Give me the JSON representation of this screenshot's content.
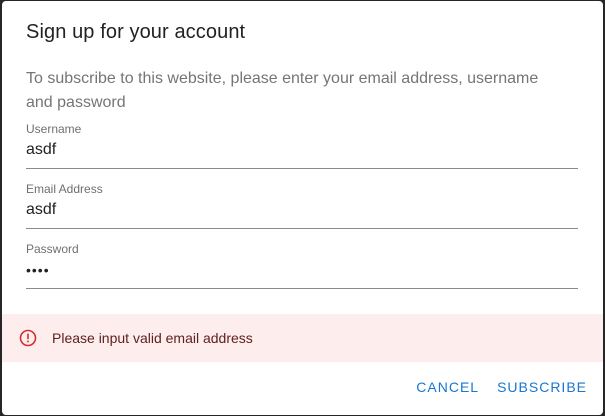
{
  "dialog": {
    "title": "Sign up for your account",
    "description": "To subscribe to this website, please enter your email address, username and password"
  },
  "fields": {
    "username": {
      "label": "Username",
      "value": "asdf"
    },
    "email": {
      "label": "Email Address",
      "value": "asdf"
    },
    "password": {
      "label": "Password",
      "value": "asdf"
    }
  },
  "alert": {
    "message": "Please input valid email address",
    "icon": "error-outline-icon",
    "color": "#d32f2f",
    "background": "#fdeded"
  },
  "actions": {
    "cancel_label": "CANCEL",
    "subscribe_label": "SUBSCRIBE"
  },
  "colors": {
    "accent": "#1976d2"
  }
}
